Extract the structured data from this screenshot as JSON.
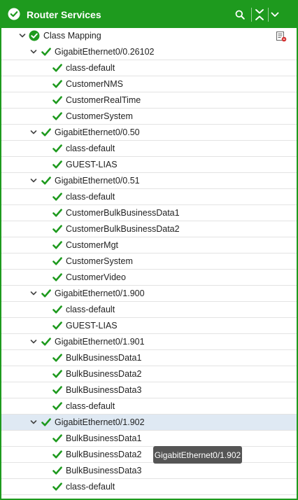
{
  "header": {
    "title": "Router Services"
  },
  "tree": {
    "root_label": "Class Mapping",
    "groups": [
      {
        "label": "GigabitEthernet0/0.26102",
        "children": [
          "class-default",
          "CustomerNMS",
          "CustomerRealTime",
          "CustomerSystem"
        ]
      },
      {
        "label": "GigabitEthernet0/0.50",
        "children": [
          "class-default",
          "GUEST-LIAS"
        ]
      },
      {
        "label": "GigabitEthernet0/0.51",
        "children": [
          "class-default",
          "CustomerBulkBusinessData1",
          "CustomerBulkBusinessData2",
          "CustomerMgt",
          "CustomerSystem",
          "CustomerVideo"
        ]
      },
      {
        "label": "GigabitEthernet0/1.900",
        "children": [
          "class-default",
          "GUEST-LIAS"
        ]
      },
      {
        "label": "GigabitEthernet0/1.901",
        "children": [
          "BulkBusinessData1",
          "BulkBusinessData2",
          "BulkBusinessData3",
          "class-default"
        ]
      },
      {
        "label": "GigabitEthernet0/1.902",
        "selected": true,
        "children": [
          "BulkBusinessData1",
          "BulkBusinessData2",
          "BulkBusinessData3",
          "class-default"
        ]
      }
    ]
  },
  "tooltip": {
    "text": "GigabitEthernet0/1.902"
  },
  "colors": {
    "brand_green": "#1e9a1e",
    "check_green": "#1e9a1e",
    "selected_row": "#dfe9f3",
    "tooltip_bg": "#555555"
  },
  "icons": {
    "header": "check-circle-icon",
    "search": "search-icon",
    "collapse_all": "collapse-all-icon",
    "expand": "chevron-down-icon",
    "list": "list-settings-icon"
  }
}
